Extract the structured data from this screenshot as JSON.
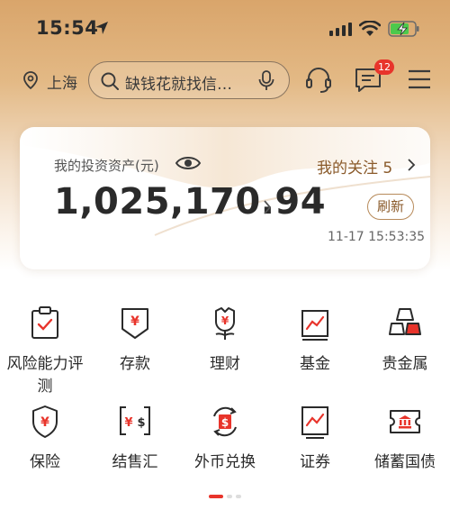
{
  "status_bar": {
    "time": "15:54"
  },
  "nav": {
    "city": "上海",
    "search_placeholder": "缺钱花就找信…",
    "badge_count": "12"
  },
  "asset_card": {
    "label": "我的投资资产(元)",
    "value": "1,025,170.94",
    "follow_label": "我的关注 5",
    "refresh_label": "刷新",
    "timestamp": "11-17 15:53:35"
  },
  "grid": {
    "row1": [
      {
        "label": "风险能力评测",
        "icon": "clipboard-check-icon"
      },
      {
        "label": "存款",
        "icon": "yuan-deposit-icon"
      },
      {
        "label": "理财",
        "icon": "flower-yuan-icon"
      },
      {
        "label": "基金",
        "icon": "chart-trend-icon"
      },
      {
        "label": "贵金属",
        "icon": "gold-bars-icon"
      }
    ],
    "row2": [
      {
        "label": "保险",
        "icon": "shield-yuan-icon"
      },
      {
        "label": "结售汇",
        "icon": "exchange-yuan-dollar-icon"
      },
      {
        "label": "外币兑换",
        "icon": "dollar-cycle-icon"
      },
      {
        "label": "证券",
        "icon": "stock-chart-icon"
      },
      {
        "label": "储蓄国债",
        "icon": "bank-ticket-icon"
      }
    ]
  },
  "colors": {
    "accent_red": "#e8342b",
    "brown": "#8a5a2a",
    "header_gold": "#d9a56b"
  },
  "pager": {
    "active_index": 0,
    "count": 3
  }
}
